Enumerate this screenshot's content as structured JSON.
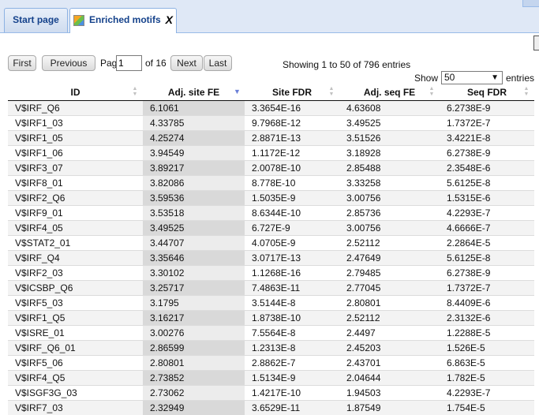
{
  "tabs": [
    {
      "label": "Start page"
    },
    {
      "label": "Enriched motifs",
      "close": "X"
    }
  ],
  "pager": {
    "first": "First",
    "previous": "Previous",
    "page_label": "Page",
    "page_value": "1",
    "of_label": "of 16",
    "next": "Next",
    "last": "Last"
  },
  "summary": "Showing 1 to 50 of 796 entries",
  "length": {
    "show_label": "Show",
    "value": "50",
    "entries_label": "entries"
  },
  "table": {
    "columns": [
      "ID",
      "Adj. site FE",
      "Site FDR",
      "Adj. seq FE",
      "Seq FDR"
    ],
    "rows": [
      [
        "V$IRF_Q6",
        "6.1061",
        "3.3654E-16",
        "4.63608",
        "6.2738E-9"
      ],
      [
        "V$IRF1_03",
        "4.33785",
        "9.7968E-12",
        "3.49525",
        "1.7372E-7"
      ],
      [
        "V$IRF1_05",
        "4.25274",
        "2.8871E-13",
        "3.51526",
        "3.4221E-8"
      ],
      [
        "V$IRF1_06",
        "3.94549",
        "1.1172E-12",
        "3.18928",
        "6.2738E-9"
      ],
      [
        "V$IRF3_07",
        "3.89217",
        "2.0078E-10",
        "2.85488",
        "2.3548E-6"
      ],
      [
        "V$IRF8_01",
        "3.82086",
        "8.778E-10",
        "3.33258",
        "5.6125E-8"
      ],
      [
        "V$IRF2_Q6",
        "3.59536",
        "1.5035E-9",
        "3.00756",
        "1.5315E-6"
      ],
      [
        "V$IRF9_01",
        "3.53518",
        "8.6344E-10",
        "2.85736",
        "4.2293E-7"
      ],
      [
        "V$IRF4_05",
        "3.49525",
        "6.727E-9",
        "3.00756",
        "4.6666E-7"
      ],
      [
        "V$STAT2_01",
        "3.44707",
        "4.0705E-9",
        "2.52112",
        "2.2864E-5"
      ],
      [
        "V$IRF_Q4",
        "3.35646",
        "3.0717E-13",
        "2.47649",
        "5.6125E-8"
      ],
      [
        "V$IRF2_03",
        "3.30102",
        "1.1268E-16",
        "2.79485",
        "6.2738E-9"
      ],
      [
        "V$ICSBP_Q6",
        "3.25717",
        "7.4863E-11",
        "2.77045",
        "1.7372E-7"
      ],
      [
        "V$IRF5_03",
        "3.1795",
        "3.5144E-8",
        "2.80801",
        "8.4409E-6"
      ],
      [
        "V$IRF1_Q5",
        "3.16217",
        "1.8738E-10",
        "2.52112",
        "2.3132E-6"
      ],
      [
        "V$ISRE_01",
        "3.00276",
        "7.5564E-8",
        "2.4497",
        "1.2288E-5"
      ],
      [
        "V$IRF_Q6_01",
        "2.86599",
        "1.2313E-8",
        "2.45203",
        "1.526E-5"
      ],
      [
        "V$IRF5_06",
        "2.80801",
        "2.8862E-7",
        "2.43701",
        "6.863E-5"
      ],
      [
        "V$IRF4_Q5",
        "2.73852",
        "1.5134E-9",
        "2.04644",
        "1.782E-5"
      ],
      [
        "V$ISGF3G_03",
        "2.73062",
        "1.4217E-10",
        "1.94503",
        "4.2293E-7"
      ],
      [
        "V$IRF7_03",
        "2.32949",
        "3.6529E-11",
        "1.87549",
        "1.754E-5"
      ]
    ]
  }
}
